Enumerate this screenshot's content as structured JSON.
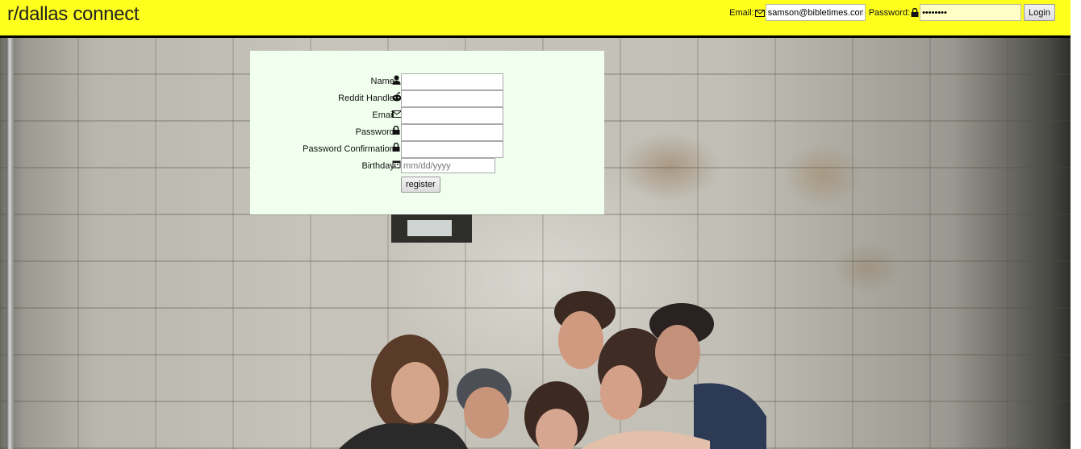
{
  "header": {
    "title": "r/dallas connect",
    "email_label": "Email:",
    "email_value": "samson@bibletimes.com",
    "password_label": "Password:",
    "password_value": "password",
    "login_label": "Login",
    "background_color": "#ffff1e"
  },
  "register_form": {
    "fields": [
      {
        "label": "Name :",
        "icon": "user-icon"
      },
      {
        "label": "Reddit Handle :",
        "icon": "reddit-alien-icon"
      },
      {
        "label": "Email :",
        "icon": "envelope-icon"
      },
      {
        "label": "Password :",
        "icon": "lock-icon"
      },
      {
        "label": "Password Confirmation :",
        "icon": "lock-icon"
      },
      {
        "label": "Birthday :",
        "icon": "calendar-icon",
        "placeholder": "mm/dd/yyyy"
      }
    ],
    "submit_label": "register",
    "background_color": "#f0ffee"
  }
}
